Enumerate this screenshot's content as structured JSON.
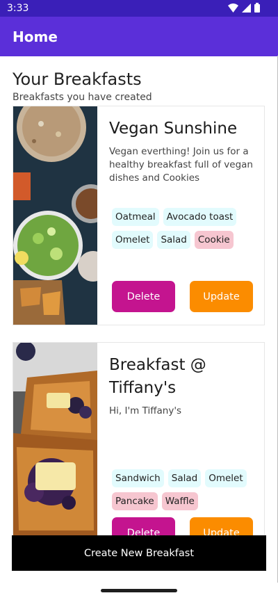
{
  "status": {
    "time": "3:33"
  },
  "appbar": {
    "title": "Home"
  },
  "section": {
    "title": "Your Breakfasts",
    "subtitle": "Breakfasts you have created"
  },
  "cards": [
    {
      "title": "Vegan Sunshine",
      "description": "Vegan everthing! Join us for a healthy breakfast full of vegan dishes and Cookies",
      "tags_cyan": [
        "Oatmeal",
        "Avocado toast",
        "Omelet",
        "Salad"
      ],
      "tags_pink": [
        "Cookie"
      ],
      "delete_label": "Delete",
      "update_label": "Update"
    },
    {
      "title": "Breakfast @ Tiffany's",
      "description": "Hi, I'm Tiffany's",
      "tags_cyan": [
        "Sandwich",
        "Salad",
        "Omelet"
      ],
      "tags_pink": [
        "Pancake",
        "Waffle"
      ],
      "delete_label": "Delete",
      "update_label": "Update"
    }
  ],
  "footer": {
    "create_label": "Create New Breakfast"
  },
  "colors": {
    "statusbar": "#3a1fb8",
    "appbar": "#5b2fd9",
    "delete": "#c4148f",
    "update": "#fb8c00",
    "tag_cyan": "#e2fbfd",
    "tag_pink": "#f6c6d0"
  },
  "icons": [
    "wifi-icon",
    "signal-icon",
    "battery-icon"
  ]
}
